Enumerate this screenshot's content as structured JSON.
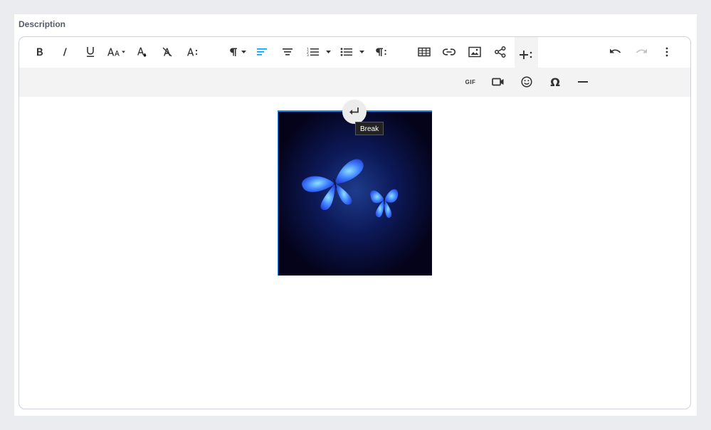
{
  "field": {
    "label": "Description"
  },
  "toolbar": {
    "icons": {
      "bold": "bold-icon",
      "italic": "italic-icon",
      "underline": "underline-icon",
      "font_size": "font-size-icon",
      "text_color": "text-color-icon",
      "clear_format": "clear-formatting-icon",
      "more_text": "more-text-icon",
      "paragraph_format": "paragraph-format-icon",
      "align": "align-left-icon",
      "align_center": "align-center-icon",
      "ordered_list": "ordered-list-icon",
      "unordered_list": "unordered-list-icon",
      "more_paragraph": "more-paragraph-icon",
      "table": "table-icon",
      "link": "link-icon",
      "image": "image-icon",
      "share": "share-icon",
      "more_rich": "insert-more-icon",
      "undo": "undo-icon",
      "redo": "redo-icon",
      "more_misc": "more-vertical-icon"
    },
    "secondary": {
      "gif_label": "GIF",
      "omega_label": "Ω"
    }
  },
  "content": {
    "tooltip": "Break"
  },
  "colors": {
    "active": "#0098f7",
    "page_bg": "#ebecf0",
    "toolbar_secondary_bg": "#f3f3f3",
    "image_border": "#1e88e5"
  }
}
